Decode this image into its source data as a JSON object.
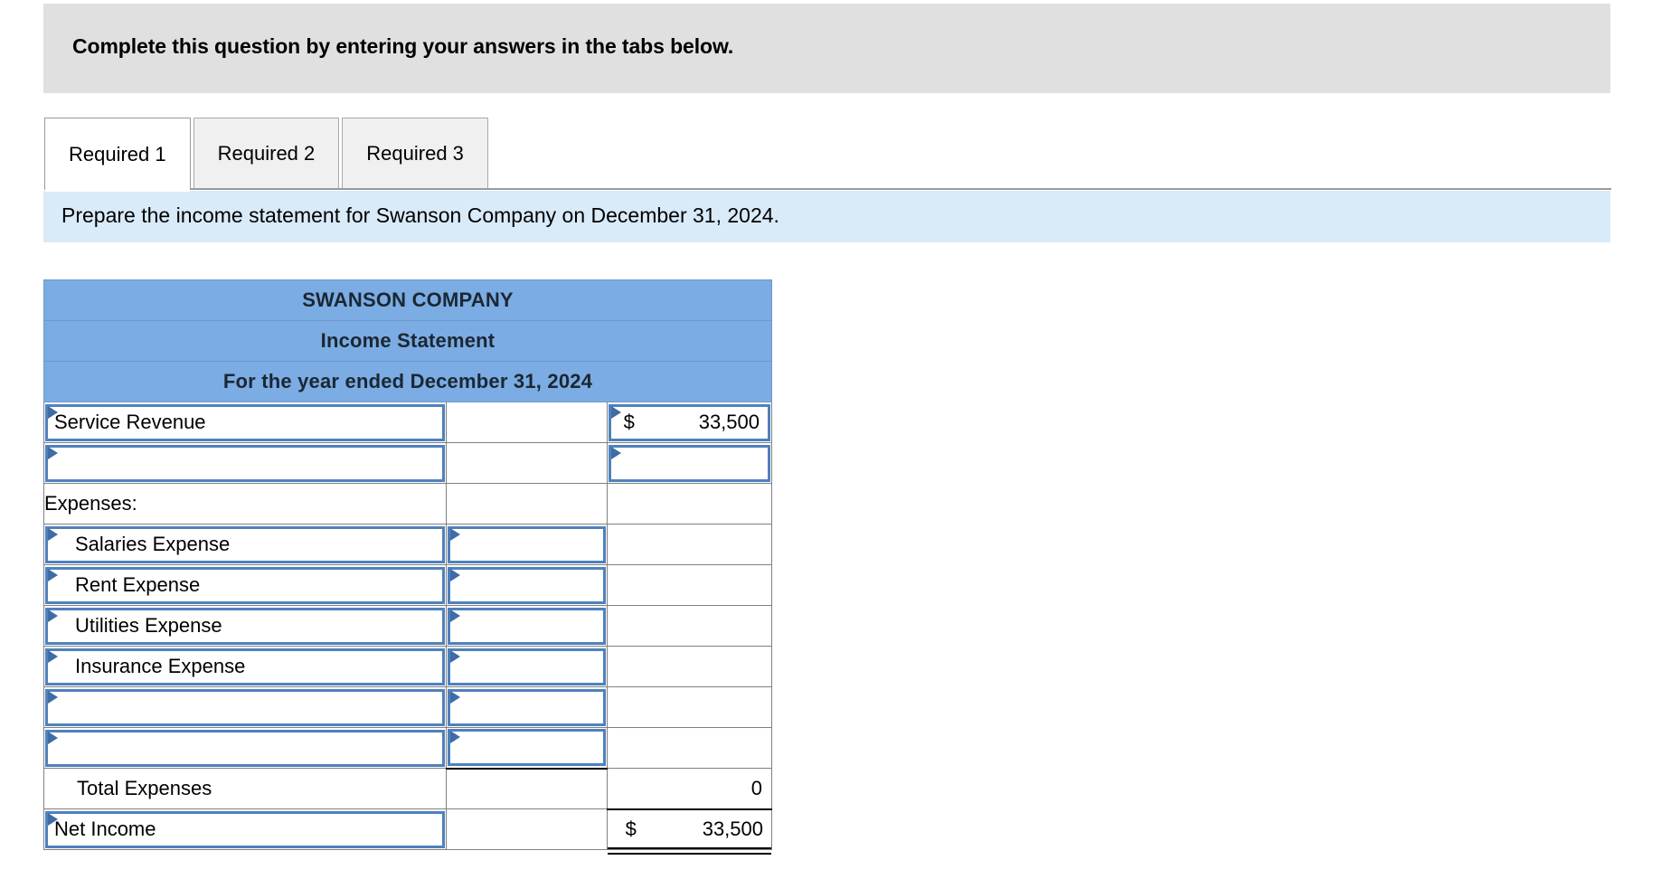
{
  "question_bar": {
    "instruction": "Complete this question by entering your answers in the tabs below."
  },
  "tabs": {
    "items": [
      {
        "label": "Required 1",
        "active": true
      },
      {
        "label": "Required 2",
        "active": false
      },
      {
        "label": "Required 3",
        "active": false
      }
    ]
  },
  "requirement_banner": {
    "text": "Prepare the income statement for Swanson Company on December 31, 2024."
  },
  "worksheet": {
    "title_rows": [
      "SWANSON COMPANY",
      "Income Statement",
      "For the year ended December 31, 2024"
    ],
    "rows": [
      {
        "name": "service-revenue",
        "label": "Service Revenue",
        "label_editable": true,
        "middle": "",
        "middle_editable": false,
        "value_symbol": "$",
        "value": "33,500",
        "value_editable": true
      },
      {
        "name": "blank-revenue",
        "label": "",
        "label_editable": true,
        "middle": "",
        "middle_editable": false,
        "value_symbol": "",
        "value": "",
        "value_editable": true
      },
      {
        "name": "expenses-heading",
        "label": "Expenses:",
        "label_editable": false,
        "middle": "",
        "middle_editable": false,
        "value_symbol": "",
        "value": "",
        "value_editable": false
      },
      {
        "name": "salaries-expense",
        "label": "Salaries Expense",
        "label_editable": true,
        "label_indent": true,
        "middle": "",
        "middle_editable": true,
        "value_symbol": "",
        "value": "",
        "value_editable": false
      },
      {
        "name": "rent-expense",
        "label": "Rent Expense",
        "label_editable": true,
        "label_indent": true,
        "middle": "",
        "middle_editable": true,
        "value_symbol": "",
        "value": "",
        "value_editable": false
      },
      {
        "name": "utilities-expense",
        "label": "Utilities Expense",
        "label_editable": true,
        "label_indent": true,
        "middle": "",
        "middle_editable": true,
        "value_symbol": "",
        "value": "",
        "value_editable": false
      },
      {
        "name": "insurance-expense",
        "label": "Insurance Expense",
        "label_editable": true,
        "label_indent": true,
        "middle": "",
        "middle_editable": true,
        "value_symbol": "",
        "value": "",
        "value_editable": false
      },
      {
        "name": "blank-expense-1",
        "label": "",
        "label_editable": true,
        "middle": "",
        "middle_editable": true,
        "value_symbol": "",
        "value": "",
        "value_editable": false
      },
      {
        "name": "blank-expense-2",
        "label": "",
        "label_editable": true,
        "middle": "",
        "middle_editable": true,
        "value_symbol": "",
        "value": "",
        "value_editable": false
      },
      {
        "name": "total-expenses",
        "label": "Total Expenses",
        "label_editable": false,
        "label_indent": true,
        "middle": "",
        "middle_editable": false,
        "value_symbol": "",
        "value": "0",
        "value_editable": false
      },
      {
        "name": "net-income",
        "label": "Net Income",
        "label_editable": true,
        "middle": "",
        "middle_editable": false,
        "value_symbol": "$",
        "value": "33,500",
        "value_editable": false
      }
    ]
  },
  "colors": {
    "header_blue": "#7bace3",
    "banner_blue": "#d9eaf9",
    "question_gray": "#e0e0e0",
    "input_border": "#4f81bd",
    "marker": "#3d6ca6"
  }
}
